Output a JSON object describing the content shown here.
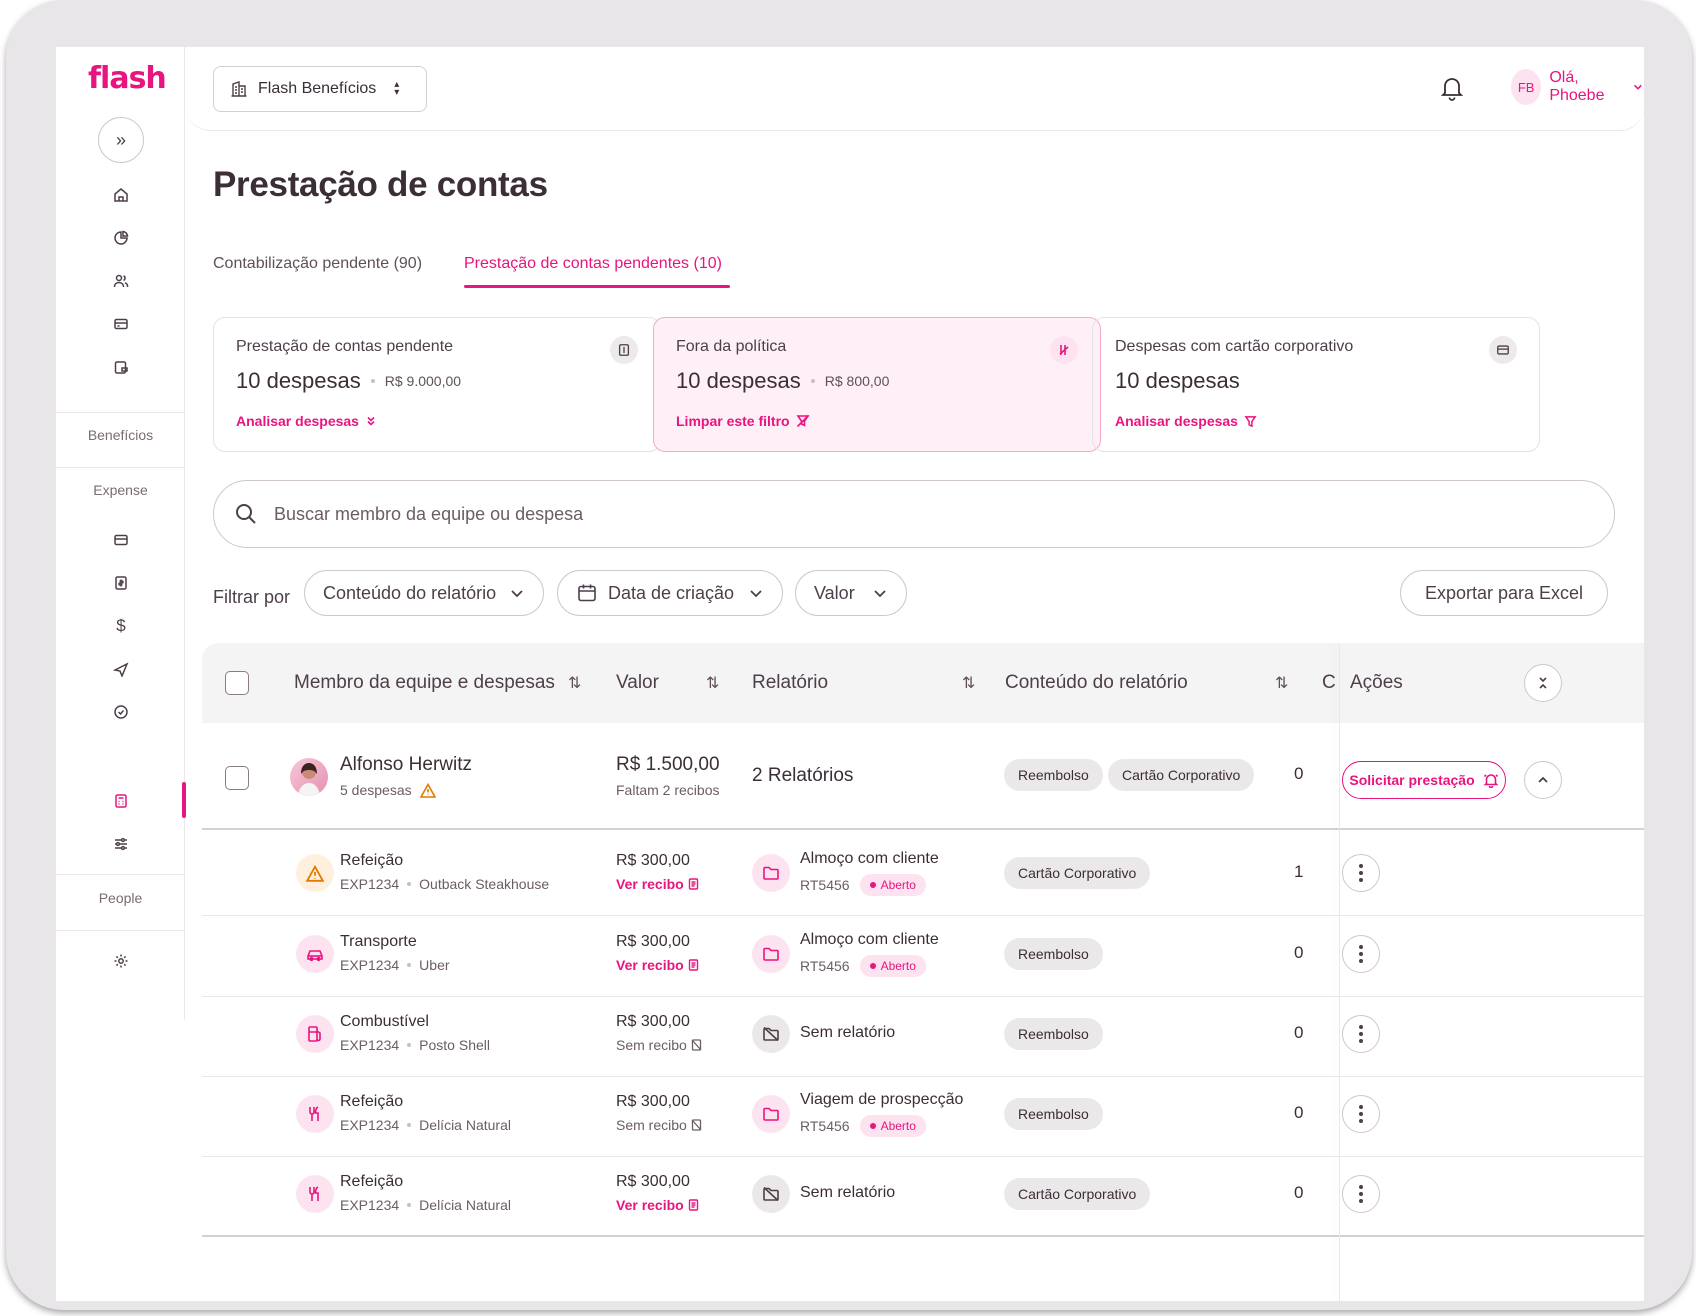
{
  "sidebar": {
    "logo": "flash",
    "sections": {
      "beneficios": "Benefícios",
      "expense": "Expense",
      "people": "People"
    }
  },
  "header": {
    "company": "Flash Benefícios",
    "user_initials": "FB",
    "greeting": "Olá, Phoebe"
  },
  "page": {
    "title": "Prestação de contas",
    "tabs": [
      {
        "label": "Contabilização pendente (90)"
      },
      {
        "label": "Prestação de contas pendentes (10)"
      }
    ]
  },
  "cards": [
    {
      "label": "Prestação de contas pendente",
      "value": "10 despesas",
      "amount": "R$ 9.000,00",
      "link": "Analisar despesas"
    },
    {
      "label": "Fora da política",
      "value": "10 despesas",
      "amount": "R$ 800,00",
      "link": "Limpar este filtro"
    },
    {
      "label": "Despesas com cartão corporativo",
      "value": "10 despesas",
      "link": "Analisar despesas"
    }
  ],
  "search": {
    "placeholder": "Buscar membro da equipe ou despesa"
  },
  "filters": {
    "label": "Filtrar por",
    "chips": [
      "Conteúdo do relatório",
      "Data de criação",
      "Valor"
    ],
    "export": "Exportar para Excel"
  },
  "table": {
    "headers": {
      "member": "Membro da equipe e despesas",
      "value": "Valor",
      "report": "Relatório",
      "content": "Conteúdo do relatório",
      "extra": "C",
      "actions": "Ações"
    },
    "group": {
      "name": "Alfonso Herwitz",
      "count": "5 despesas",
      "value": "R$ 1.500,00",
      "missing": "Faltam 2 recibos",
      "reports": "2 Relatórios",
      "tags": [
        "Reembolso",
        "Cartão Corporativo"
      ],
      "extra": "0",
      "action": "Solicitar prestação"
    },
    "rows": [
      {
        "category": "Refeição",
        "code": "EXP1234",
        "merchant": "Outback Steakhouse",
        "value": "R$ 300,00",
        "receipt": "Ver recibo",
        "report": "Almoço com cliente",
        "report_code": "RT5456",
        "status": "Aberto",
        "tag": "Cartão Corporativo",
        "extra": "1"
      },
      {
        "category": "Transporte",
        "code": "EXP1234",
        "merchant": "Uber",
        "value": "R$ 300,00",
        "receipt": "Ver recibo",
        "report": "Almoço com cliente",
        "report_code": "RT5456",
        "status": "Aberto",
        "tag": "Reembolso",
        "extra": "0"
      },
      {
        "category": "Combustível",
        "code": "EXP1234",
        "merchant": "Posto Shell",
        "value": "R$ 300,00",
        "receipt": "Sem recibo",
        "report": "Sem relatório",
        "tag": "Reembolso",
        "extra": "0"
      },
      {
        "category": "Refeição",
        "code": "EXP1234",
        "merchant": "Delícia Natural",
        "value": "R$ 300,00",
        "receipt": "Sem recibo",
        "report": "Viagem de prospecção",
        "report_code": "RT5456",
        "status": "Aberto",
        "tag": "Reembolso",
        "extra": "0"
      },
      {
        "category": "Refeição",
        "code": "EXP1234",
        "merchant": "Delícia Natural",
        "value": "R$ 300,00",
        "receipt": "Ver recibo",
        "report": "Sem relatório",
        "tag": "Cartão Corporativo",
        "extra": "0"
      }
    ]
  },
  "colors": {
    "brand": "#e8147f",
    "warning": "#e07b00",
    "text": "#3b2e37"
  }
}
